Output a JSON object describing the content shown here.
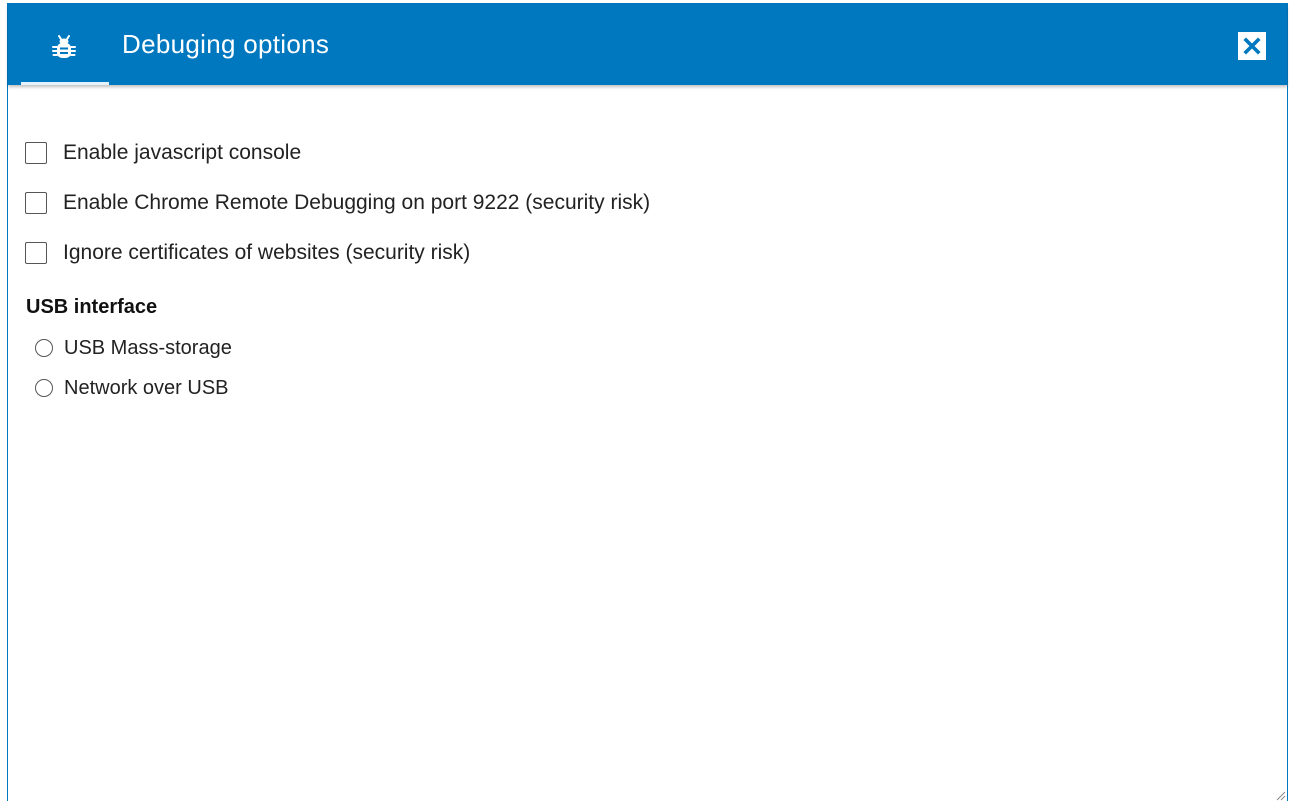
{
  "dialog": {
    "title": "Debuging options",
    "title_icon": "bug-icon",
    "close_icon": "close-icon",
    "accent_color": "#0078c0"
  },
  "options": {
    "checkboxes": [
      {
        "label": "Enable javascript console",
        "checked": false
      },
      {
        "label": "Enable Chrome Remote Debugging on port 9222 (security risk)",
        "checked": false
      },
      {
        "label": "Ignore certificates of websites (security risk)",
        "checked": false
      }
    ],
    "usb": {
      "heading": "USB interface",
      "radios": [
        {
          "label": "USB Mass-storage",
          "selected": false
        },
        {
          "label": "Network over USB",
          "selected": false
        }
      ]
    }
  }
}
